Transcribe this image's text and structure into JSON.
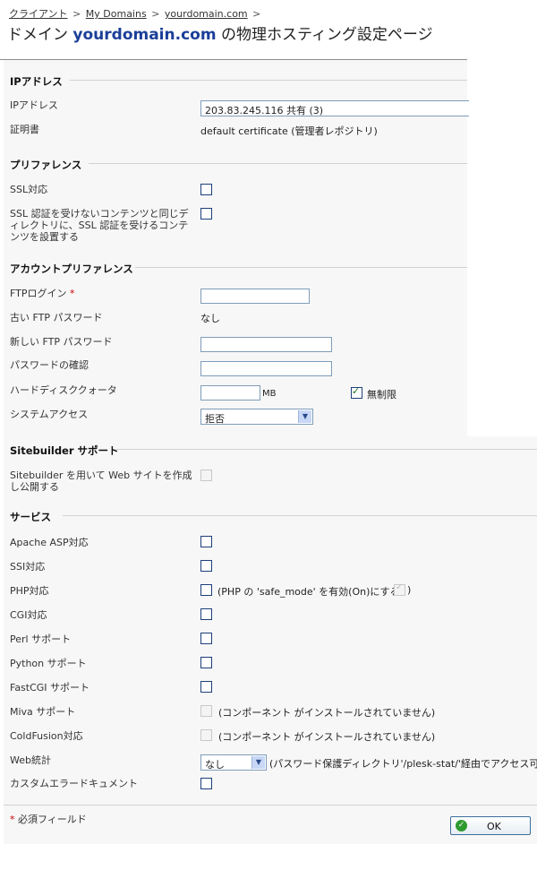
{
  "breadcrumb": {
    "item1": "クライアント",
    "item2": "My Domains",
    "item3": "yourdomain.com",
    "separator": ">"
  },
  "title": {
    "prefix": "ドメイン ",
    "domain": "yourdomain.com",
    "suffix": " の物理ホスティング設定ページ"
  },
  "ip_section": {
    "heading": "IPアドレス",
    "ip_label": "IPアドレス",
    "ip_value": "203.83.245.116 共有 (3)",
    "cert_label": "証明書",
    "cert_value": "default certificate (管理者レポジトリ)"
  },
  "pref_section": {
    "heading": "プリファレンス",
    "ssl_label": "SSL対応",
    "ssl_same_dir_label": "SSL 認証を受けないコンテンツと同じディレクトリに、SSL 認証を受けるコンテンツを設置する"
  },
  "account_section": {
    "heading": "アカウントプリファレンス",
    "ftp_login_label": "FTPログイン",
    "required_mark": "*",
    "old_pw_label": "古い FTP パスワード",
    "old_pw_value": "なし",
    "new_pw_label": "新しい FTP パスワード",
    "confirm_pw_label": "パスワードの確認",
    "quota_label": "ハードディスククォータ",
    "quota_unit": "MB",
    "unlimited_label": "無制限",
    "shell_label": "システムアクセス",
    "shell_value": "拒否"
  },
  "sitebuilder_section": {
    "heading": "Sitebuilder サポート",
    "publish_label": "Sitebuilder を用いて Web サイトを作成し公開する"
  },
  "services_section": {
    "heading": "サービス",
    "asp_label": "Apache ASP対応",
    "ssi_label": "SSI対応",
    "php_label": "PHP対応",
    "php_note_pre": "(PHP の 'safe_mode' を有効(On)にする",
    "php_note_post": ")",
    "cgi_label": "CGI対応",
    "perl_label": "Perl サポート",
    "python_label": "Python サポート",
    "fastcgi_label": "FastCGI サポート",
    "miva_label": "Miva サポート",
    "miva_note": "(コンポーネント がインストールされていません)",
    "coldfusion_label": "ColdFusion対応",
    "coldfusion_note": "(コンポーネント がインストールされていません)",
    "webstat_label": "Web統計",
    "webstat_value": "なし",
    "webstat_note": "(パスワード保護ディレクトリ'/plesk-stat/'経由でアクセス可能",
    "errdocs_label": "カスタムエラードキュメント"
  },
  "footer": {
    "required_mark": "*",
    "required_note": " 必須フィールド",
    "ok_label": "OK"
  }
}
